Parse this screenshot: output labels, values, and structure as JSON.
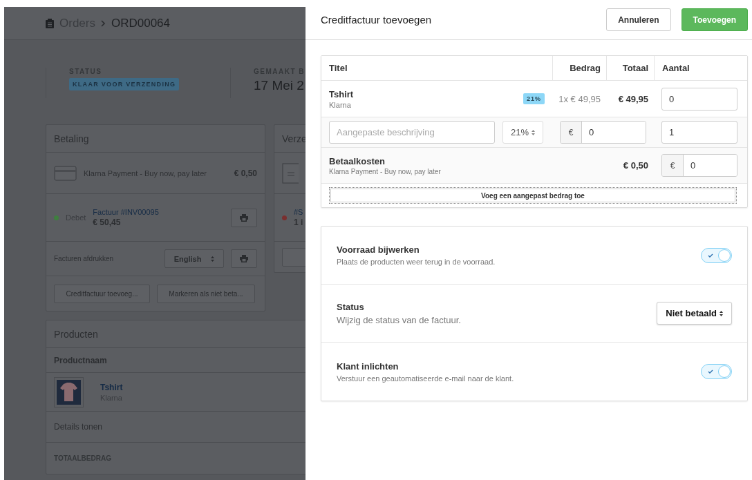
{
  "background": {
    "breadcrumb": {
      "parent": "Orders",
      "current": "ORD00064"
    },
    "status": {
      "label": "STATUS",
      "value": "KLAAR VOOR VERZENDING"
    },
    "created": {
      "label": "GEMAAKT B",
      "value": "17 Mei 2"
    },
    "payment_card": {
      "title": "Betaling",
      "method": "Klarna Payment - Buy now, pay later",
      "amount": "€ 0,50",
      "invoice": {
        "status": "Debet",
        "link": "Factuur #INV00095",
        "amount": "€ 50,45"
      },
      "print_label": "Facturen afdrukken",
      "language": "English",
      "buttons": [
        "Creditfactuur toevoeg...",
        "Markeren als niet beta..."
      ]
    },
    "shipping_card": {
      "title": "Verze",
      "link": "#S",
      "count": "1 i"
    },
    "products_card": {
      "title": "Producten",
      "column": "Productnaam",
      "product": {
        "name": "Tshirt",
        "variant": "Klarna"
      },
      "details": "Details tonen",
      "total_label": "TOTAALBEDRAG"
    }
  },
  "dialog": {
    "title": "Creditfactuur toevoegen",
    "buttons": [
      {
        "label": "Annuleren",
        "kind": "secondary"
      },
      {
        "label": "Toevoegen",
        "kind": "primary"
      }
    ],
    "table": {
      "columns": [
        "Titel",
        "Bedrag",
        "Totaal",
        "Aantal"
      ],
      "rows": [
        {
          "kind": "product",
          "title": "Tshirt",
          "subtitle": "Klarna",
          "tax": "21%",
          "price": "1x € 49,95",
          "total": "€ 49,95",
          "quantity": "0"
        },
        {
          "kind": "custom",
          "placeholder": "Aangepaste beschrijving",
          "tax": "21%",
          "currency": "€",
          "amount": "0",
          "quantity": "1"
        },
        {
          "kind": "fee",
          "title": "Betaalkosten",
          "subtitle": "Klarna Payment - Buy now, pay later",
          "total": "€ 0,50",
          "currency": "€",
          "amount": "0"
        }
      ],
      "add_button": "Voeg een aangepast bedrag toe"
    },
    "settings": [
      {
        "kind": "toggle",
        "title": "Voorraad bijwerken",
        "description": "Plaats de producten weer terug in de voorraad.",
        "on": true
      },
      {
        "kind": "select",
        "title": "Status",
        "description": "Wijzig de status van de factuur.",
        "value": "Niet betaald"
      },
      {
        "kind": "toggle",
        "title": "Klant inlichten",
        "description": "Verstuur een geautomatiseerde e-mail naar de klant.",
        "on": true
      }
    ]
  }
}
